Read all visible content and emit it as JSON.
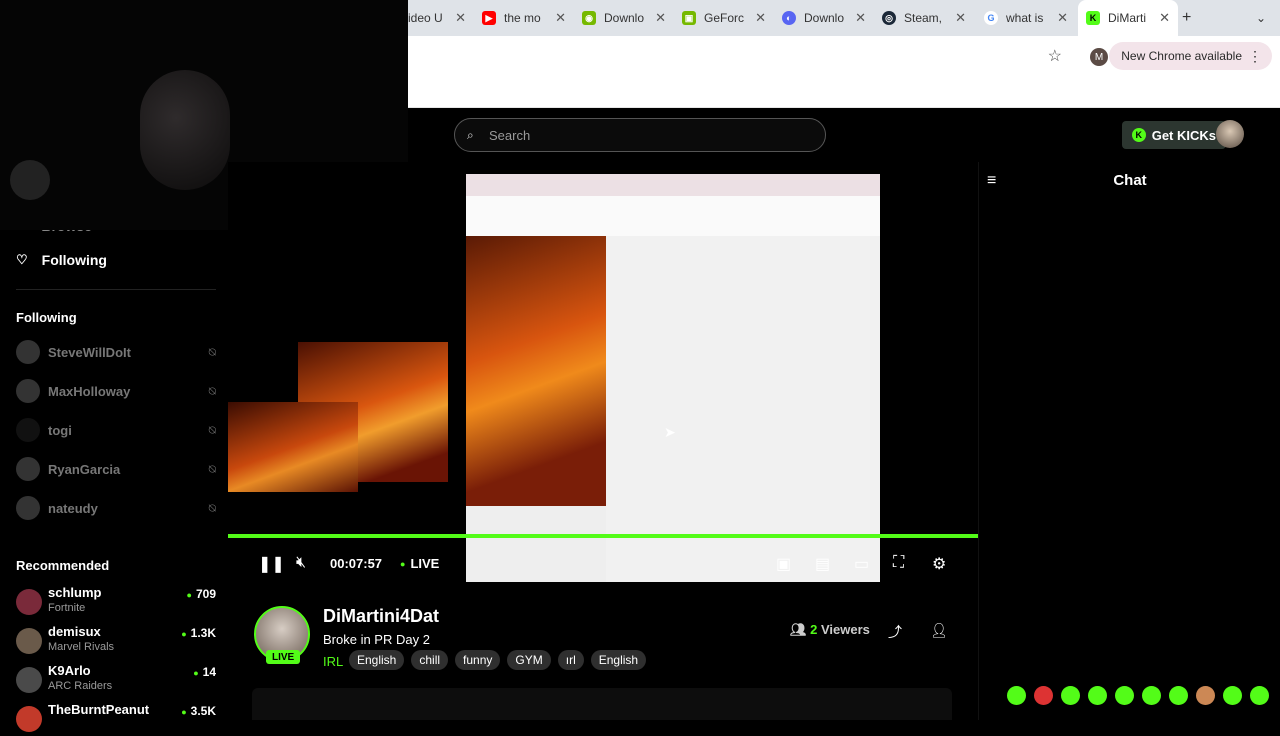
{
  "browser": {
    "tabs": [
      {
        "label": "ideo U",
        "icon": "video-icon",
        "color": "#888888"
      },
      {
        "label": "the mo",
        "icon": "youtube-icon",
        "color": "#ff0000"
      },
      {
        "label": "Downlo",
        "icon": "nvidia-icon",
        "color": "#76b900"
      },
      {
        "label": "GeForc",
        "icon": "geforce-icon",
        "color": "#76b900"
      },
      {
        "label": "Downlo",
        "icon": "discord-icon",
        "color": "#5865f2"
      },
      {
        "label": "Steam,",
        "icon": "steam-icon",
        "color": "#1b2838"
      },
      {
        "label": "what is",
        "icon": "google-icon",
        "color": "#4285f4"
      },
      {
        "label": "DiMarti",
        "icon": "kick-icon",
        "color": "#53fc18",
        "active": true
      }
    ],
    "new_tab": "+",
    "profile_initial": "M",
    "update_notice": "New Chrome available"
  },
  "header": {
    "search_placeholder": "Search",
    "get_kicks": "Get KICKs"
  },
  "sidebar": {
    "browse": "Browse",
    "following_nav": "Following",
    "following_heading": "Following",
    "following": [
      "SteveWillDoIt",
      "MaxHolloway",
      "togi",
      "RyanGarcia",
      "nateudy"
    ],
    "recommended_heading": "Recommended",
    "recommended": [
      {
        "name": "schlump",
        "game": "Fortnite",
        "viewers": "709"
      },
      {
        "name": "demisux",
        "game": "Marvel Rivals",
        "viewers": "1.3K"
      },
      {
        "name": "K9Arlo",
        "game": "ARC Raiders",
        "viewers": "14"
      },
      {
        "name": "TheBurntPeanut",
        "game": "",
        "viewers": "3.5K"
      }
    ]
  },
  "player": {
    "time": "00:07:57",
    "live": "LIVE",
    "progress_fraction": 1.0
  },
  "chat": {
    "title": "Chat"
  },
  "stream": {
    "channel": "DiMartini4Dat",
    "title": "Broke in PR Day 2",
    "category": "IRL",
    "tags": [
      "English",
      "chill",
      "funny",
      "GYM",
      "ırl",
      "English"
    ],
    "viewers_count": "2",
    "viewers_label": "Viewers",
    "live_badge": "LIVE"
  },
  "colors": {
    "kick_green": "#53fc18"
  }
}
